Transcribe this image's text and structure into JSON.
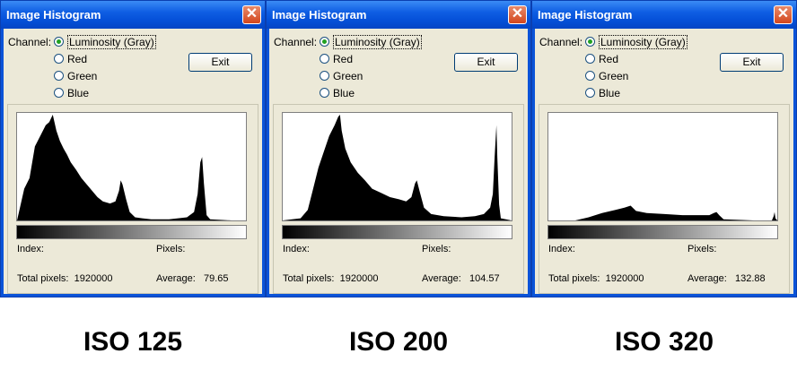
{
  "windows": [
    {
      "title": "Image Histogram",
      "channel_label": "Channel:",
      "channels": [
        "Luminosity (Gray)",
        "Red",
        "Green",
        "Blue"
      ],
      "selected_channel": 0,
      "exit_label": "Exit",
      "index_label": "Index:",
      "pixels_label": "Pixels:",
      "total_label": "Total pixels:",
      "total_value": "1920000",
      "average_label": "Average:",
      "average_value": "79.65",
      "iso_label": "ISO 125",
      "histogram": [
        [
          0,
          0.0
        ],
        [
          8,
          0.3
        ],
        [
          14,
          0.4
        ],
        [
          20,
          0.7
        ],
        [
          26,
          0.8
        ],
        [
          32,
          0.9
        ],
        [
          36,
          0.93
        ],
        [
          40,
          1.0
        ],
        [
          44,
          0.85
        ],
        [
          48,
          0.75
        ],
        [
          52,
          0.68
        ],
        [
          56,
          0.62
        ],
        [
          60,
          0.55
        ],
        [
          66,
          0.48
        ],
        [
          72,
          0.4
        ],
        [
          78,
          0.34
        ],
        [
          84,
          0.28
        ],
        [
          90,
          0.22
        ],
        [
          96,
          0.18
        ],
        [
          104,
          0.16
        ],
        [
          110,
          0.18
        ],
        [
          114,
          0.28
        ],
        [
          116,
          0.38
        ],
        [
          118,
          0.34
        ],
        [
          122,
          0.2
        ],
        [
          126,
          0.08
        ],
        [
          132,
          0.03
        ],
        [
          140,
          0.02
        ],
        [
          150,
          0.01
        ],
        [
          170,
          0.01
        ],
        [
          180,
          0.02
        ],
        [
          190,
          0.03
        ],
        [
          198,
          0.08
        ],
        [
          202,
          0.25
        ],
        [
          205,
          0.55
        ],
        [
          207,
          0.6
        ],
        [
          209,
          0.35
        ],
        [
          212,
          0.05
        ],
        [
          216,
          0.01
        ],
        [
          240,
          0.0
        ],
        [
          256,
          0.0
        ]
      ]
    },
    {
      "title": "Image Histogram",
      "channel_label": "Channel:",
      "channels": [
        "Luminosity (Gray)",
        "Red",
        "Green",
        "Blue"
      ],
      "selected_channel": 0,
      "exit_label": "Exit",
      "index_label": "Index:",
      "pixels_label": "Pixels:",
      "total_label": "Total pixels:",
      "total_value": "1920000",
      "average_label": "Average:",
      "average_value": "104.57",
      "iso_label": "ISO 200",
      "histogram": [
        [
          0,
          0.0
        ],
        [
          20,
          0.02
        ],
        [
          28,
          0.1
        ],
        [
          34,
          0.3
        ],
        [
          40,
          0.5
        ],
        [
          46,
          0.65
        ],
        [
          52,
          0.8
        ],
        [
          58,
          0.9
        ],
        [
          62,
          0.98
        ],
        [
          64,
          1.0
        ],
        [
          66,
          0.85
        ],
        [
          70,
          0.68
        ],
        [
          76,
          0.55
        ],
        [
          84,
          0.45
        ],
        [
          92,
          0.38
        ],
        [
          100,
          0.3
        ],
        [
          110,
          0.26
        ],
        [
          120,
          0.22
        ],
        [
          130,
          0.2
        ],
        [
          138,
          0.18
        ],
        [
          144,
          0.22
        ],
        [
          148,
          0.35
        ],
        [
          150,
          0.38
        ],
        [
          153,
          0.28
        ],
        [
          158,
          0.12
        ],
        [
          166,
          0.06
        ],
        [
          180,
          0.04
        ],
        [
          200,
          0.03
        ],
        [
          215,
          0.04
        ],
        [
          225,
          0.06
        ],
        [
          232,
          0.12
        ],
        [
          235,
          0.25
        ],
        [
          237,
          0.6
        ],
        [
          239,
          0.9
        ],
        [
          240,
          0.6
        ],
        [
          242,
          0.15
        ],
        [
          244,
          0.02
        ],
        [
          256,
          0.0
        ]
      ]
    },
    {
      "title": "Image Histogram",
      "channel_label": "Channel:",
      "channels": [
        "Luminosity (Gray)",
        "Red",
        "Green",
        "Blue"
      ],
      "selected_channel": 0,
      "exit_label": "Exit",
      "index_label": "Index:",
      "pixels_label": "Pixels:",
      "total_label": "Total pixels:",
      "total_value": "1920000",
      "average_label": "Average:",
      "average_value": "132.88",
      "iso_label": "ISO 320",
      "histogram": [
        [
          0,
          0.0
        ],
        [
          30,
          0.0
        ],
        [
          45,
          0.03
        ],
        [
          60,
          0.07
        ],
        [
          75,
          0.1
        ],
        [
          85,
          0.12
        ],
        [
          92,
          0.14
        ],
        [
          98,
          0.09
        ],
        [
          110,
          0.07
        ],
        [
          130,
          0.06
        ],
        [
          150,
          0.05
        ],
        [
          170,
          0.05
        ],
        [
          180,
          0.05
        ],
        [
          185,
          0.07
        ],
        [
          188,
          0.08
        ],
        [
          191,
          0.05
        ],
        [
          196,
          0.01
        ],
        [
          230,
          0.0
        ],
        [
          250,
          0.0
        ],
        [
          252,
          0.04
        ],
        [
          253,
          0.08
        ],
        [
          254,
          0.02
        ],
        [
          256,
          0.0
        ]
      ]
    }
  ]
}
